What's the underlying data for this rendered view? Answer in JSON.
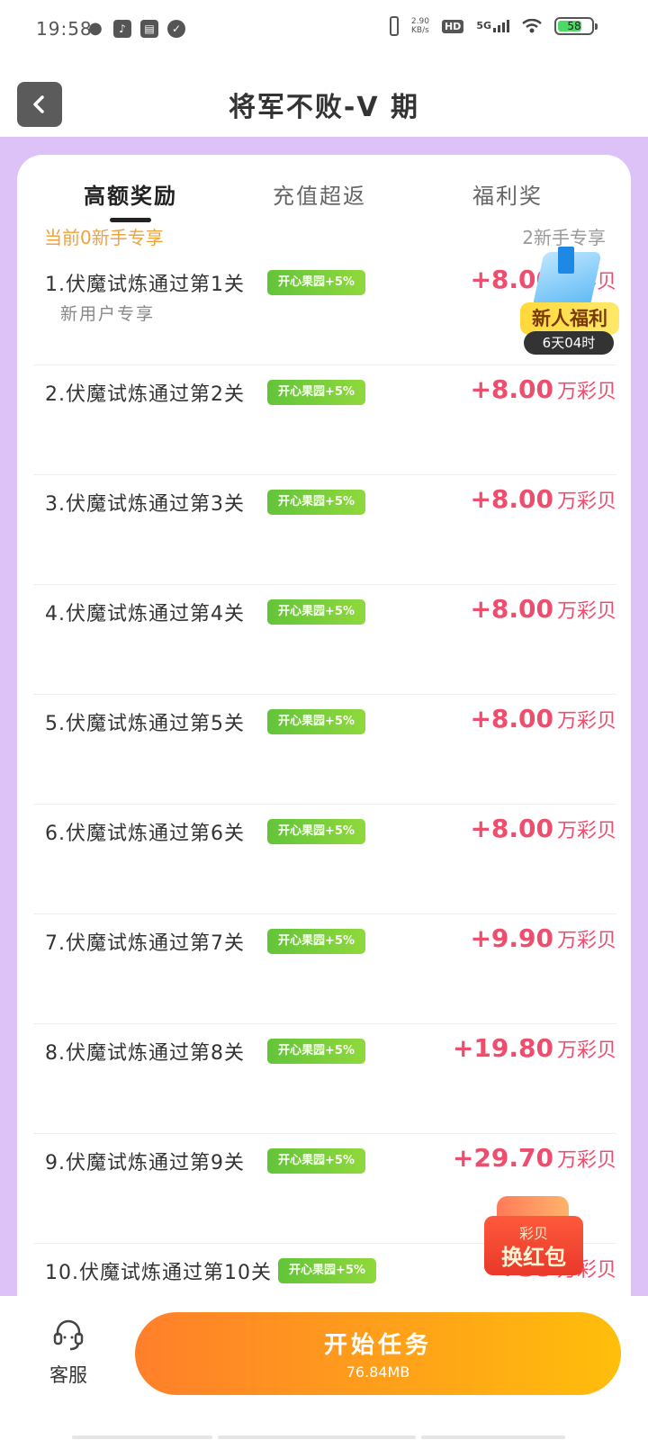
{
  "status_bar": {
    "time": "19:58",
    "net_speed_value": "2.90",
    "net_speed_unit": "KB/s",
    "hd_label": "HD",
    "network_label": "5G",
    "battery_level": "58"
  },
  "header": {
    "title": "将军不败-V 期"
  },
  "tabs": [
    {
      "label": "高额奖励"
    },
    {
      "label": "充值超返"
    },
    {
      "label": "福利奖"
    }
  ],
  "subheader": {
    "left": "当前0新手专享",
    "right": "2新手专享"
  },
  "tasks": [
    {
      "name": "1.伏魔试炼通过第1关",
      "subtitle": "新用户专享",
      "badge": "开心果园+5%",
      "amount": "+8.00",
      "unit": "万彩贝"
    },
    {
      "name": "2.伏魔试炼通过第2关",
      "badge": "开心果园+5%",
      "amount": "+8.00",
      "unit": "万彩贝"
    },
    {
      "name": "3.伏魔试炼通过第3关",
      "badge": "开心果园+5%",
      "amount": "+8.00",
      "unit": "万彩贝"
    },
    {
      "name": "4.伏魔试炼通过第4关",
      "badge": "开心果园+5%",
      "amount": "+8.00",
      "unit": "万彩贝"
    },
    {
      "name": "5.伏魔试炼通过第5关",
      "badge": "开心果园+5%",
      "amount": "+8.00",
      "unit": "万彩贝"
    },
    {
      "name": "6.伏魔试炼通过第6关",
      "badge": "开心果园+5%",
      "amount": "+8.00",
      "unit": "万彩贝"
    },
    {
      "name": "7.伏魔试炼通过第7关",
      "badge": "开心果园+5%",
      "amount": "+9.90",
      "unit": "万彩贝"
    },
    {
      "name": "8.伏魔试炼通过第8关",
      "badge": "开心果园+5%",
      "amount": "+19.80",
      "unit": "万彩贝"
    },
    {
      "name": "9.伏魔试炼通过第9关",
      "badge": "开心果园+5%",
      "amount": "+29.70",
      "unit": "万彩贝"
    },
    {
      "name": "10.伏魔试炼通过第10关",
      "badge": "开心果园+5%",
      "amount": "+39",
      "unit": "万彩贝"
    }
  ],
  "newbie_promo": {
    "label": "新人福利",
    "timer": "6天04时"
  },
  "red_packet": {
    "line1": "彩贝",
    "line2": "换红包"
  },
  "bottom_bar": {
    "service_label": "客服",
    "start_label": "开始任务",
    "start_size": "76.84MB"
  },
  "colors": {
    "accent_pink": "#ee4e6e",
    "badge_green": "#63c439",
    "frame_lavender": "#dcc2f6",
    "button_orange": "#ff7f2a",
    "button_yellow": "#ffbe0b"
  }
}
